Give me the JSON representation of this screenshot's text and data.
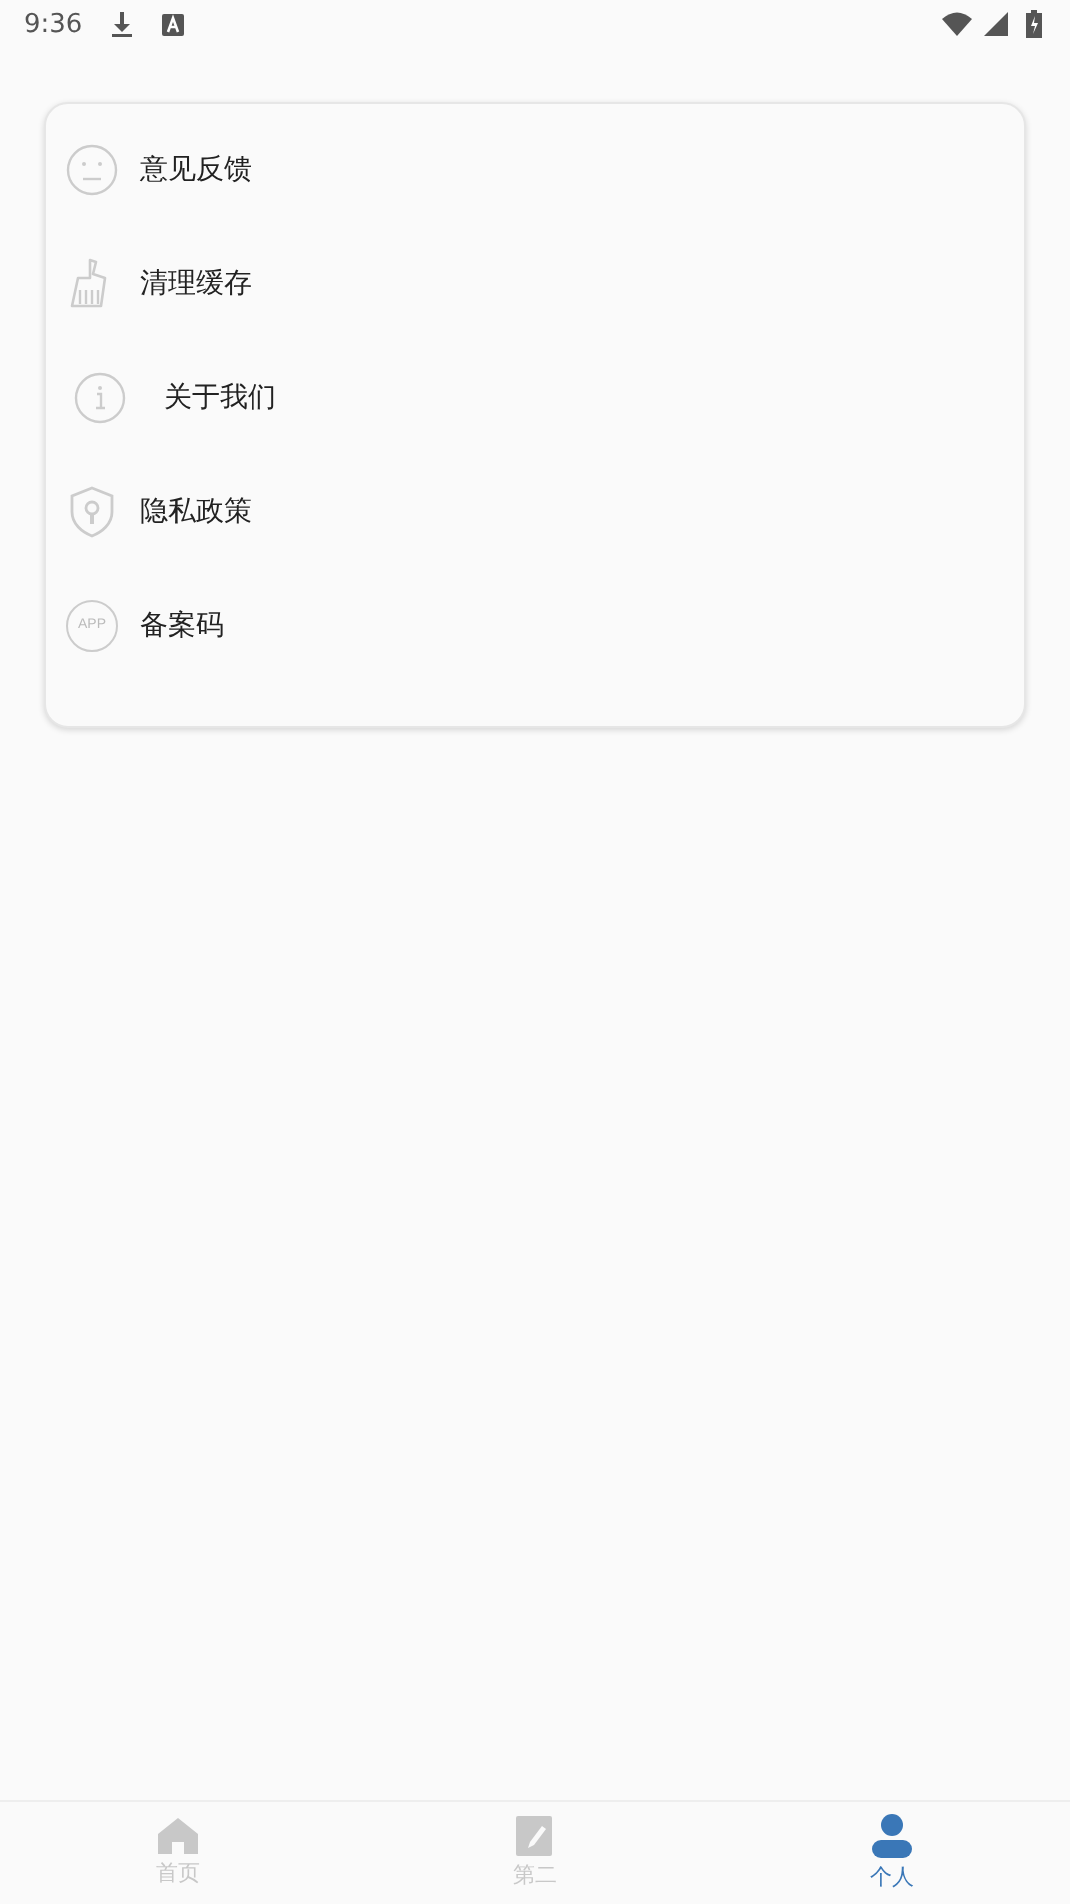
{
  "status_bar": {
    "time": "9:36"
  },
  "menu": [
    {
      "kind": "feedback",
      "label": "意见反馈"
    },
    {
      "kind": "clean",
      "label": "清理缓存"
    },
    {
      "kind": "about",
      "label": "关于我们"
    },
    {
      "kind": "privacy",
      "label": "隐私政策"
    },
    {
      "kind": "record",
      "label": "备案码",
      "icon_text": "APP"
    }
  ],
  "tabs": [
    {
      "kind": "home",
      "label": "首页",
      "selected": false
    },
    {
      "kind": "second",
      "label": "第二",
      "selected": false
    },
    {
      "kind": "person",
      "label": "个人",
      "selected": true
    }
  ]
}
